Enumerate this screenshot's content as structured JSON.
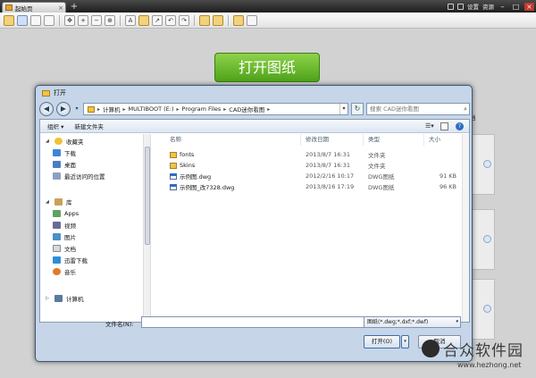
{
  "app": {
    "tab_title": "起始页",
    "tab_close": "×",
    "new_tab": "+",
    "top_links": [
      "设置",
      "资源"
    ],
    "open_drawing_label": "打开图纸",
    "background_label": "档"
  },
  "toolbar": {
    "icons": [
      "open-folder-icon",
      "save-icon",
      "print-icon",
      "print-preview-icon",
      "pan-icon",
      "zoom-in-icon",
      "zoom-out-icon",
      "zoom-extents-icon",
      "text-icon",
      "pen-icon",
      "measure-icon",
      "undo-icon",
      "redo-icon",
      "layer-icon",
      "layout-icon",
      "share-icon",
      "export-icon"
    ]
  },
  "dialog": {
    "title": "打开",
    "path": [
      "计算机",
      "MULTIBOOT (E:)",
      "Program Files",
      "CAD迷你看图"
    ],
    "search_placeholder": "搜索 CAD迷你看图",
    "organize": "组织 ▾",
    "new_folder": "新建文件夹",
    "nav": [
      {
        "label": "收藏夹",
        "icon": "star"
      },
      {
        "label": "下载",
        "icon": "dl"
      },
      {
        "label": "桌面",
        "icon": "desk"
      },
      {
        "label": "最近访问的位置",
        "icon": "rec"
      },
      {
        "label": "库",
        "icon": "lib"
      },
      {
        "label": "Apps",
        "icon": "apps"
      },
      {
        "label": "视频",
        "icon": "vid"
      },
      {
        "label": "图片",
        "icon": "pic"
      },
      {
        "label": "文档",
        "icon": "doc"
      },
      {
        "label": "迅雷下载",
        "icon": "xl"
      },
      {
        "label": "音乐",
        "icon": "mus"
      },
      {
        "label": "计算机",
        "icon": "pc"
      }
    ],
    "columns": [
      "名称",
      "修改日期",
      "类型",
      "大小"
    ],
    "files": [
      {
        "name": "fonts",
        "date": "2013/8/7 16:31",
        "type": "文件夹",
        "size": "",
        "kind": "folder"
      },
      {
        "name": "Skins",
        "date": "2013/8/7 16:31",
        "type": "文件夹",
        "size": "",
        "kind": "folder"
      },
      {
        "name": "示例图.dwg",
        "date": "2012/2/16 10:17",
        "type": "DWG图纸",
        "size": "91 KB",
        "kind": "dwg"
      },
      {
        "name": "示例图_改7328.dwg",
        "date": "2013/8/16 17:19",
        "type": "DWG图纸",
        "size": "96 KB",
        "kind": "dwg"
      }
    ],
    "filename_label": "文件名(N):",
    "filename_value": "",
    "filter": "图纸(*.dwg;*.dxf;*.dwf)",
    "open_button": "打开(O)",
    "cancel_button": "取消"
  },
  "watermark": {
    "title": "合众软件园",
    "url": "www.hezhong.net"
  }
}
